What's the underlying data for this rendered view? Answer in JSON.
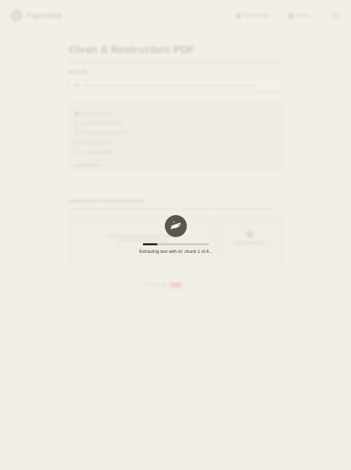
{
  "header": {
    "logo_name": "PaperStack",
    "nav": [
      {
        "label": "Contribute",
        "icon": "star-icon"
      },
      {
        "label": "Docs",
        "icon": "document-icon"
      }
    ],
    "menu_icon": "hamburger-menu-icon"
  },
  "main": {
    "title": "Clean & Restructure PDF",
    "url_label": "Add URL",
    "upload_section_label": "Upload to the Conversion Viewer",
    "alt_card_label": "Paste Markdown",
    "powered_by": "Powered by"
  },
  "loader": {
    "icon": "chef-bird-icon",
    "status": "Extracting text with AI: chunk 1 of 8...",
    "progress": 0.22
  },
  "colors": {
    "background": "#f2efe8",
    "loader_icon_bg": "#5a5651",
    "progress_fill": "#2b2925"
  }
}
